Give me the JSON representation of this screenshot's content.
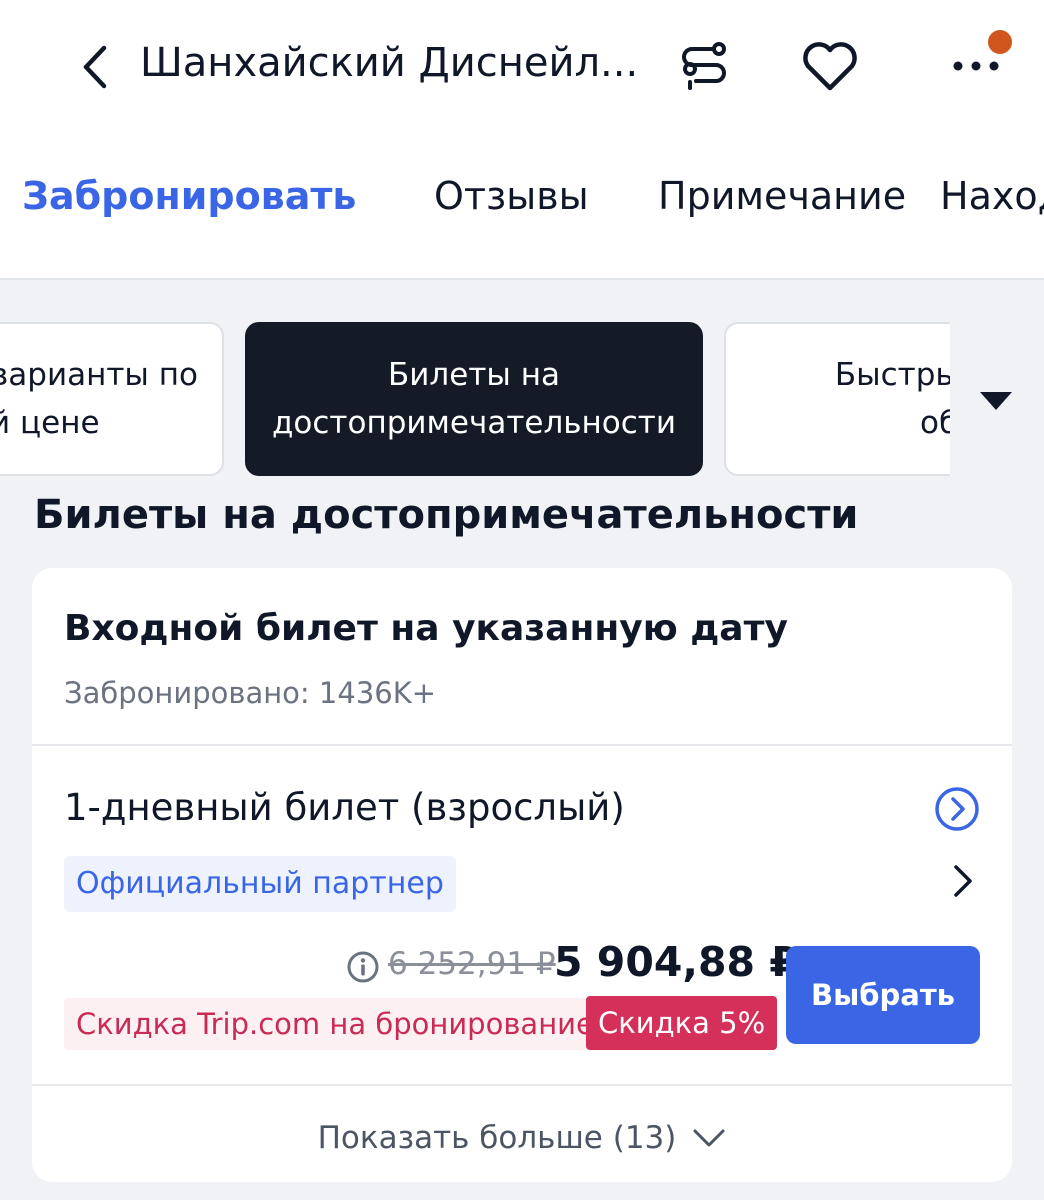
{
  "header": {
    "title": "Шанхайский Диснейл...",
    "icons": [
      "back-arrow-icon",
      "route-icon",
      "heart-icon",
      "more-icon"
    ],
    "notification_dot_color": "#d0561d"
  },
  "tabs": [
    {
      "label": "Забронировать",
      "active": true
    },
    {
      "label": "Отзывы",
      "active": false
    },
    {
      "label": "Примечание",
      "active": false
    },
    {
      "label": "Наход",
      "active": false
    }
  ],
  "filters": [
    {
      "label": "варианты по\nй цене",
      "active": false
    },
    {
      "label": "Билеты на\nдостопримечательности",
      "active": true
    },
    {
      "label": "Быстрый\nобъ",
      "active": false
    }
  ],
  "section": {
    "title": "Билеты на достопримечательности"
  },
  "card": {
    "title": "Входной билет на указанную дату",
    "booked": "Забронировано: 1436K+",
    "ticket": {
      "name": "1-дневный билет (взрослый)",
      "partner_badge": "Официальный партнер",
      "old_price": "6 252,91 ₽",
      "price": "5 904,88 ₽",
      "promo": "Скидка Trip.com на бронирование",
      "discount": "Скидка 5%",
      "select_label": "Выбрать"
    },
    "show_more": "Показать больше (13)"
  },
  "colors": {
    "accent": "#3a66e6",
    "discount": "#d4305a",
    "dark_chip": "#141a26"
  }
}
